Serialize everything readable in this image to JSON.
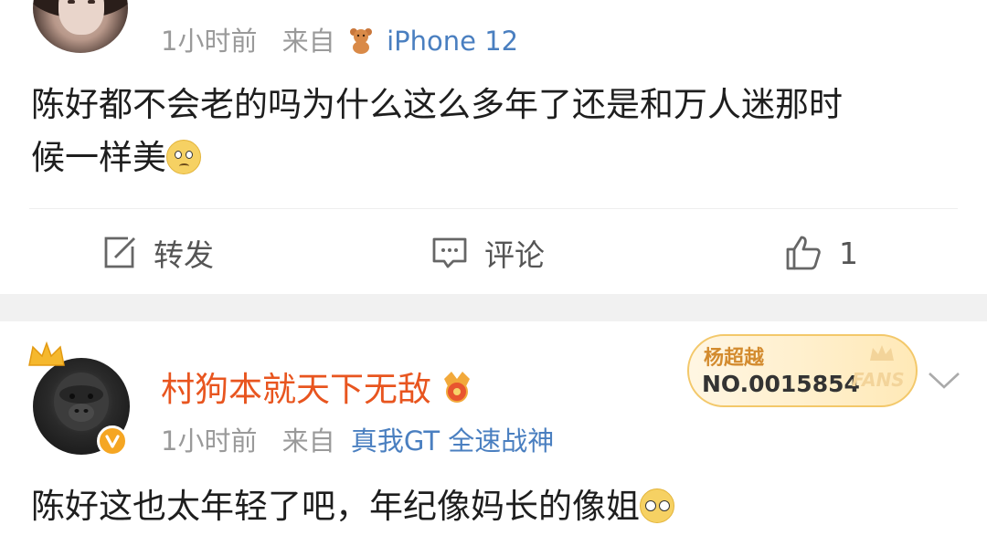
{
  "post1": {
    "time": "1小时前",
    "from_label": "来自",
    "source": "iPhone 12",
    "content_line1": "陈好都不会老的吗为什么这么多年了还是和万人迷那时",
    "content_line2": "候一样美",
    "actions": {
      "repost_label": "转发",
      "comment_label": "评论",
      "like_count": "1"
    }
  },
  "post2": {
    "username": "村狗本就天下无敌",
    "time": "1小时前",
    "from_label": "来自",
    "source": "真我GT 全速战神",
    "content": "陈好这也太年轻了吧，年纪像妈长的像姐",
    "fans_badge": {
      "title": "杨超越",
      "number": "NO.0015854",
      "word": "FANS"
    }
  },
  "colors": {
    "source_link": "#4a7fc0",
    "username": "#e8551f",
    "meta_gray": "#9a9a9a",
    "section_gap": "#f1f1f1"
  },
  "icons": [
    "user-avatar",
    "bear-icon",
    "smile-emoji",
    "repost-icon",
    "comment-icon",
    "like-icon",
    "crown-icon",
    "verified-badge",
    "medal-icon",
    "chevron-down-icon",
    "glasses-emoji"
  ]
}
